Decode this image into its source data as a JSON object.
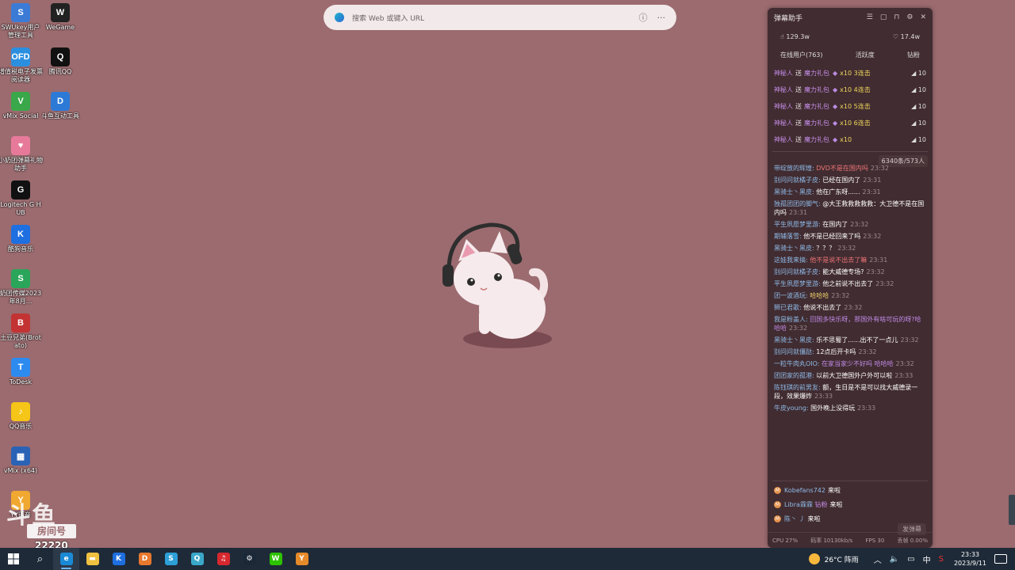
{
  "desktop_icons": [
    {
      "label": "SWUkey用户管理工具",
      "icon": "key-manager-icon",
      "color": "#3b7bd6",
      "glyph": "S"
    },
    {
      "label": "WeGame",
      "icon": "wegame-icon",
      "color": "#222222",
      "glyph": "W"
    },
    {
      "label": "增值税电子发票阅读器",
      "icon": "invoice-reader-icon",
      "color": "#2b8fe0",
      "glyph": "OFD"
    },
    {
      "label": "腾讯QQ",
      "icon": "qq-penguin-icon",
      "color": "#111111",
      "glyph": "Q"
    },
    {
      "label": "vMix Social",
      "icon": "vmix-social-icon",
      "color": "#3aa74a",
      "glyph": "V"
    },
    {
      "label": "斗鱼互动工具",
      "icon": "douyu-tool-icon",
      "color": "#2d7ad6",
      "glyph": "D"
    },
    {
      "label": "小奶团弹幕礼物助手",
      "icon": "danmu-assistant-icon",
      "color": "#e77a9a",
      "glyph": "♥"
    },
    {
      "label": "Logitech G HUB",
      "icon": "logitech-icon",
      "color": "#111111",
      "glyph": "G"
    },
    {
      "label": "酷狗音乐",
      "icon": "kugou-icon",
      "color": "#1e6fe0",
      "glyph": "K"
    },
    {
      "label": "奶团传媒2023年8月...",
      "icon": "spreadsheet-icon",
      "color": "#2aa55a",
      "glyph": "S"
    },
    {
      "label": "土豆兄弟(Brotato)",
      "icon": "brotato-icon",
      "color": "#c33333",
      "glyph": "B"
    },
    {
      "label": "ToDesk",
      "icon": "todesk-icon",
      "color": "#2d8bf0",
      "glyph": "T"
    },
    {
      "label": "QQ音乐",
      "icon": "qq-music-icon",
      "color": "#f5c518",
      "glyph": "♪"
    },
    {
      "label": "vMix (x64)",
      "icon": "vmix-icon",
      "color": "#2a62b5",
      "glyph": "▦"
    },
    {
      "label": "YY语音",
      "icon": "yy-icon",
      "color": "#f0a830",
      "glyph": "Y"
    }
  ],
  "search": {
    "placeholder": "搜索 Web 或键入 URL"
  },
  "panel": {
    "title": "弹幕助手",
    "stats": {
      "likes": "129.3w",
      "hearts": "17.4w"
    },
    "tabs": [
      "在线用户(763)",
      "活跃度",
      "钻粉"
    ],
    "gifts": [
      {
        "user": "神秘人",
        "send": "送",
        "gift": "魔力礼包",
        "count": "x10 3连击",
        "amount": "10"
      },
      {
        "user": "神秘人",
        "send": "送",
        "gift": "魔力礼包",
        "count": "x10 4连击",
        "amount": "10"
      },
      {
        "user": "神秘人",
        "send": "送",
        "gift": "魔力礼包",
        "count": "x10 5连击",
        "amount": "10"
      },
      {
        "user": "神秘人",
        "send": "送",
        "gift": "魔力礼包",
        "count": "x10 6连击",
        "amount": "10"
      },
      {
        "user": "神秘人",
        "send": "送",
        "gift": "魔力礼包",
        "count": "x10",
        "amount": "10"
      }
    ],
    "count_badge": "6340条/573人",
    "messages": [
      {
        "user": "带绽放的辉煌:",
        "text": "DVD不是在国内吗",
        "time": "23:32",
        "style": "red"
      },
      {
        "user": "别问问就橘子皮:",
        "text": "已经在国内了",
        "time": "23:31",
        "style": ""
      },
      {
        "user": "黑骑士丶黑皮:",
        "text": "他在广东呀......",
        "time": "23:31",
        "style": ""
      },
      {
        "user": "独孤团团的脚气:",
        "text": "@大王救救救救救：大卫德不是在国内吗",
        "time": "23:31",
        "style": ""
      },
      {
        "user": "平生夙愿梦里游:",
        "text": "在国内了",
        "time": "23:32",
        "style": ""
      },
      {
        "user": "期辅落雪:",
        "text": "他不是已经回来了吗",
        "time": "23:32",
        "style": ""
      },
      {
        "user": "黑骑士丶黑皮:",
        "text": "？？？",
        "time": "23:32",
        "style": ""
      },
      {
        "user": "这娃我来搞:",
        "text": "他不是说不出去了嘛",
        "time": "23:31",
        "style": "red"
      },
      {
        "user": "别问问就橘子皮:",
        "text": "能大威德专场?",
        "time": "23:32",
        "style": ""
      },
      {
        "user": "平生夙愿梦里游:",
        "text": "他之前说不出去了",
        "time": "23:32",
        "style": ""
      },
      {
        "user": "团一波酒玩:",
        "text": "哈哈哈",
        "time": "23:32",
        "style": "yel"
      },
      {
        "user": "狮已君歌:",
        "text": "他说不出去了",
        "time": "23:32",
        "style": ""
      },
      {
        "user": "我是粉盖人:",
        "text": "回国多快乐呀，那国外有啥可玩的呀?哈哈哈",
        "time": "23:32",
        "style": "pur"
      },
      {
        "user": "黑骑士丶黑皮:",
        "text": "乐不思蜀了......出不了一点儿",
        "time": "23:32",
        "style": ""
      },
      {
        "user": "别问问就僵跶:",
        "text": "12点后开卡吗",
        "time": "23:32",
        "style": ""
      },
      {
        "user": "一粒牛肉丸OIO:",
        "text": "在家当家少不好吗 哈哈哈",
        "time": "23:32",
        "style": "pur"
      },
      {
        "user": "团团家的孤港:",
        "text": "以前大卫德国外户外可以啦",
        "time": "23:33",
        "style": ""
      },
      {
        "user": "陈钰琪的前男友:",
        "text": "额，生日是不是可以找大威德录一段，效果爆炸",
        "time": "23:33",
        "style": ""
      },
      {
        "user": "牛皮young:",
        "text": "国外晚上没得玩",
        "time": "23:33",
        "style": ""
      }
    ],
    "enters": [
      {
        "level": "M",
        "user": "Kobefans742",
        "highlight": "",
        "action": "来啦"
      },
      {
        "level": "M",
        "user": "Libra霖霖 ",
        "highlight": "钻粉",
        "action": "来啦"
      },
      {
        "level": "M",
        "user": "陈丶 丿",
        "highlight": "",
        "action": "来啦"
      }
    ],
    "send_button": "发弹幕",
    "footer": {
      "cpu": "CPU 27%",
      "bitrate": "码率 10130kb/s",
      "fps": "FPS 30",
      "lag": "丢帧 0.00%"
    }
  },
  "watermark": {
    "logo": "斗鱼",
    "room_label": "房间号",
    "room_number": "22220"
  },
  "taskbar": {
    "weather": "26°C 阵雨",
    "tray_lang": "中",
    "time": "23:33",
    "date": "2023/9/11",
    "apps": [
      {
        "icon": "edge-icon",
        "color": "#1a8ad6",
        "glyph": "e",
        "active": true
      },
      {
        "icon": "file-explorer-icon",
        "color": "#f0c040",
        "glyph": "▬",
        "active": false
      },
      {
        "icon": "kugou-taskbar-icon",
        "color": "#1e6fe0",
        "glyph": "K",
        "active": false
      },
      {
        "icon": "douyu-taskbar-icon",
        "color": "#e8782e",
        "glyph": "D",
        "active": false
      },
      {
        "icon": "tool-taskbar-icon",
        "color": "#2d9fd6",
        "glyph": "S",
        "active": false
      },
      {
        "icon": "search-app-icon",
        "color": "#3aa7c9",
        "glyph": "Q",
        "active": false
      },
      {
        "icon": "netease-music-icon",
        "color": "#d6282e",
        "glyph": "♫",
        "active": false
      },
      {
        "icon": "steam-icon",
        "color": "#1b2838",
        "glyph": "⚙",
        "active": false
      },
      {
        "icon": "wechat-icon",
        "color": "#2dc100",
        "glyph": "W",
        "active": false
      },
      {
        "icon": "yy-taskbar-icon",
        "color": "#e58a2a",
        "glyph": "Y",
        "active": false
      }
    ]
  }
}
